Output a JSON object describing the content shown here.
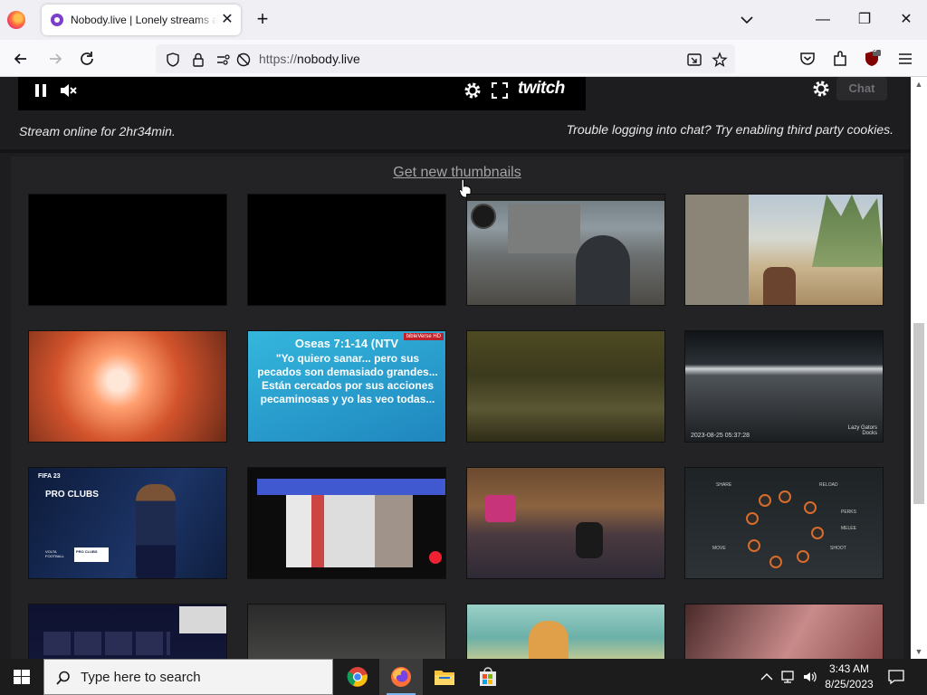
{
  "browser": {
    "tab_title": "Nobody.live | Lonely streams and more",
    "tab_close": "✕",
    "new_tab": "+",
    "url_prefix": "https://",
    "url_host": "nobody.live",
    "extension_badge": "5",
    "window_minimize": "—",
    "window_restore": "❐",
    "window_close": "✕"
  },
  "player": {
    "twitch_logo": "twitch",
    "chat_button": "Chat"
  },
  "status": {
    "stream_online": "Stream online for 2hr34min.",
    "chat_notice": "Trouble logging into chat? Try enabling third party cookies."
  },
  "thumbnails": {
    "get_new_label": "Get new thumbnails",
    "items": [
      {
        "kind": "blank"
      },
      {
        "kind": "blank"
      },
      {
        "kind": "fps-street"
      },
      {
        "kind": "fps-desert"
      },
      {
        "kind": "orange-blast"
      },
      {
        "kind": "bible-verse",
        "title": "Oseas 7:1-14 (NTV",
        "badge": "bibleVerse HD",
        "body": "\"Yo quiero sanar... pero sus pecados son demasiado grandes... Están cercados por sus acciones pecaminosas y yo las veo todas..."
      },
      {
        "kind": "dark-field"
      },
      {
        "kind": "dock-cam",
        "stamp": "2023-08-25 05:37:28",
        "label": "Lazy Gators Docks"
      },
      {
        "kind": "fifa",
        "game": "FIFA 23",
        "menu_title": "PRO CLUBS",
        "submenu": "PRO CLUBS",
        "footer": "VOLTA FOOTBALL"
      },
      {
        "kind": "webcam"
      },
      {
        "kind": "indoor-shooter"
      },
      {
        "kind": "ring-menu",
        "items": [
          "SHARE",
          "RELOAD",
          "PERKS",
          "MELEE",
          "SHOOT",
          "MOVE"
        ]
      },
      {
        "kind": "fut-menu"
      },
      {
        "kind": "forest"
      },
      {
        "kind": "cartoon"
      },
      {
        "kind": "pink-fps"
      }
    ]
  },
  "taskbar": {
    "search_placeholder": "Type here to search",
    "time": "3:43 AM",
    "date": "8/25/2023"
  },
  "colors": {
    "page_bg": "#1d1d1f",
    "panel_bg": "#232325",
    "link": "#a3a3a8",
    "twitch_purple": "#9146ff"
  }
}
